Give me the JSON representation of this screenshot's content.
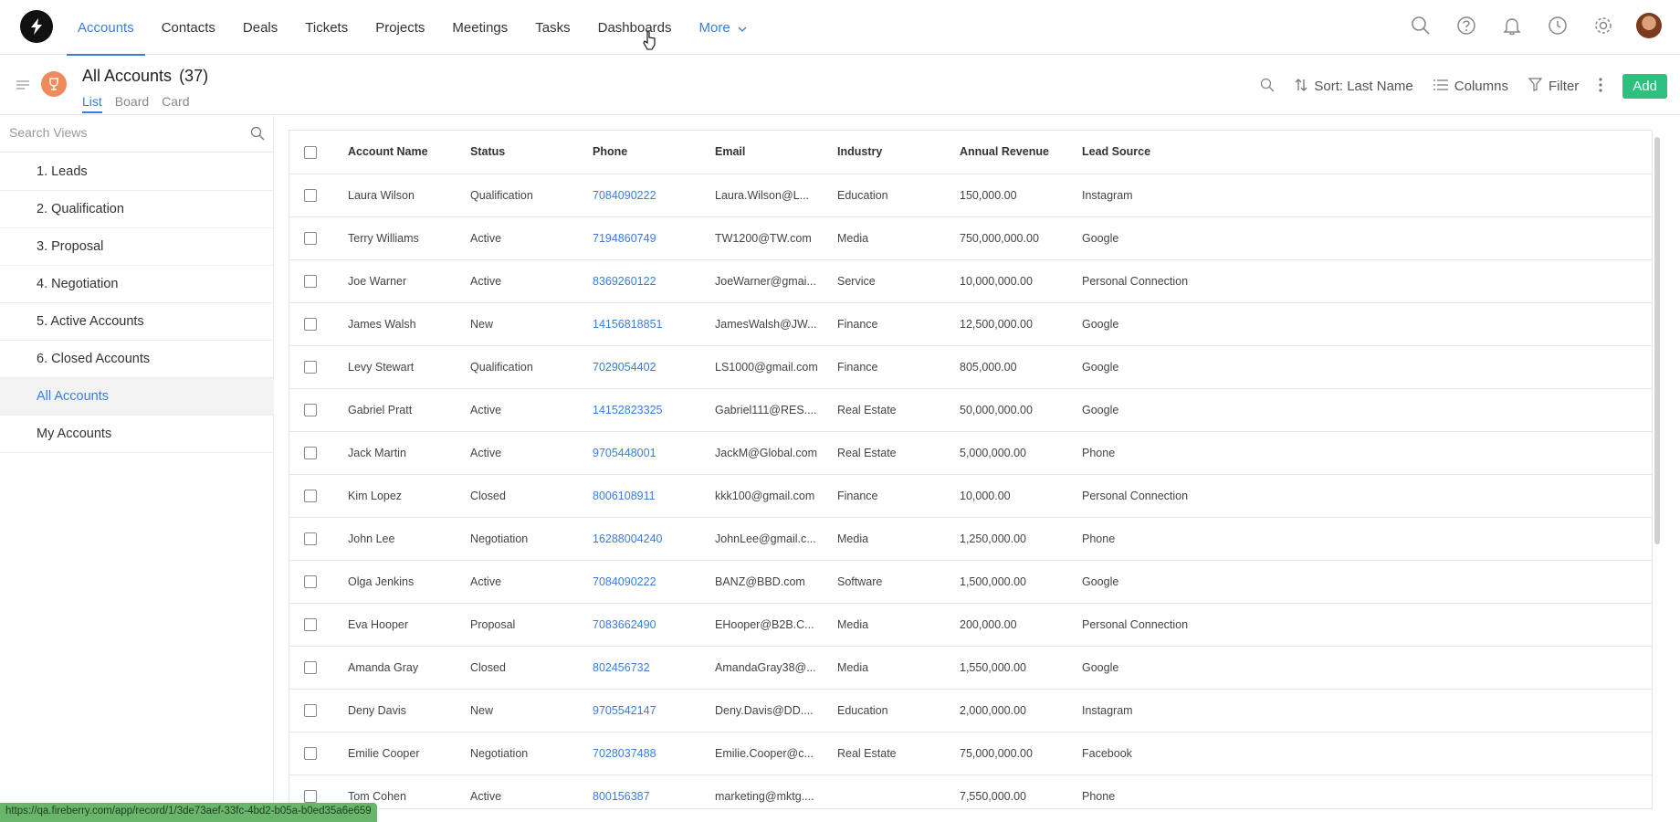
{
  "nav": {
    "tabs": [
      {
        "label": "Accounts"
      },
      {
        "label": "Contacts"
      },
      {
        "label": "Deals"
      },
      {
        "label": "Tickets"
      },
      {
        "label": "Projects"
      },
      {
        "label": "Meetings"
      },
      {
        "label": "Tasks"
      },
      {
        "label": "Dashboards"
      }
    ],
    "more_label": "More"
  },
  "header": {
    "title": "All Accounts",
    "count": "(37)",
    "view_tabs": [
      "List",
      "Board",
      "Card"
    ],
    "sort_label": "Sort: Last Name",
    "columns_label": "Columns",
    "filter_label": "Filter",
    "add_label": "Add"
  },
  "sidebar": {
    "search_placeholder": "Search Views",
    "items": [
      {
        "label": "1. Leads"
      },
      {
        "label": "2. Qualification"
      },
      {
        "label": "3. Proposal"
      },
      {
        "label": "4. Negotiation"
      },
      {
        "label": "5. Active Accounts"
      },
      {
        "label": "6. Closed Accounts"
      },
      {
        "label": "All Accounts"
      },
      {
        "label": "My Accounts"
      }
    ]
  },
  "table": {
    "columns": [
      "Account Name",
      "Status",
      "Phone",
      "Email",
      "Industry",
      "Annual Revenue",
      "Lead Source"
    ],
    "rows": [
      [
        "Laura Wilson",
        "Qualification",
        "7084090222",
        "Laura.Wilson@L...",
        "Education",
        "150,000.00",
        "Instagram"
      ],
      [
        "Terry Williams",
        "Active",
        "7194860749",
        "TW1200@TW.com",
        "Media",
        "750,000,000.00",
        "Google"
      ],
      [
        "Joe Warner",
        "Active",
        "8369260122",
        "JoeWarner@gmai...",
        "Service",
        "10,000,000.00",
        "Personal Connection"
      ],
      [
        "James Walsh",
        "New",
        "14156818851",
        "JamesWalsh@JW...",
        "Finance",
        "12,500,000.00",
        "Google"
      ],
      [
        "Levy Stewart",
        "Qualification",
        "7029054402",
        "LS1000@gmail.com",
        "Finance",
        "805,000.00",
        "Google"
      ],
      [
        "Gabriel Pratt",
        "Active",
        "14152823325",
        "Gabriel111@RES....",
        "Real Estate",
        "50,000,000.00",
        "Google"
      ],
      [
        "Jack Martin",
        "Active",
        "9705448001",
        "JackM@Global.com",
        "Real Estate",
        "5,000,000.00",
        "Phone"
      ],
      [
        "Kim Lopez",
        "Closed",
        "8006108911",
        "kkk100@gmail.com",
        "Finance",
        "10,000.00",
        "Personal Connection"
      ],
      [
        "John Lee",
        "Negotiation",
        "16288004240",
        "JohnLee@gmail.c...",
        "Media",
        "1,250,000.00",
        "Phone"
      ],
      [
        "Olga Jenkins",
        "Active",
        "7084090222",
        "BANZ@BBD.com",
        "Software",
        "1,500,000.00",
        "Google"
      ],
      [
        "Eva Hooper",
        "Proposal",
        "7083662490",
        "EHooper@B2B.C...",
        "Media",
        "200,000.00",
        "Personal Connection"
      ],
      [
        "Amanda Gray",
        "Closed",
        "802456732",
        "AmandaGray38@...",
        "Media",
        "1,550,000.00",
        "Google"
      ],
      [
        "Deny Davis",
        "New",
        "9705542147",
        "Deny.Davis@DD....",
        "Education",
        "2,000,000.00",
        "Instagram"
      ],
      [
        "Emilie Cooper",
        "Negotiation",
        "7028037488",
        "Emilie.Cooper@c...",
        "Real Estate",
        "75,000,000.00",
        "Facebook"
      ],
      [
        "Tom Cohen",
        "Active",
        "800156387",
        "marketing@mktg....",
        "",
        "7,550,000.00",
        "Phone"
      ]
    ]
  },
  "status_url": "https://qa.fireberry.com/app/record/1/3de73aef-33fc-4bd2-b05a-b0ed35a6e659",
  "colors": {
    "accent": "#3b7ddd",
    "add_button": "#2fbf7f",
    "trophy": "#f08a5d"
  }
}
